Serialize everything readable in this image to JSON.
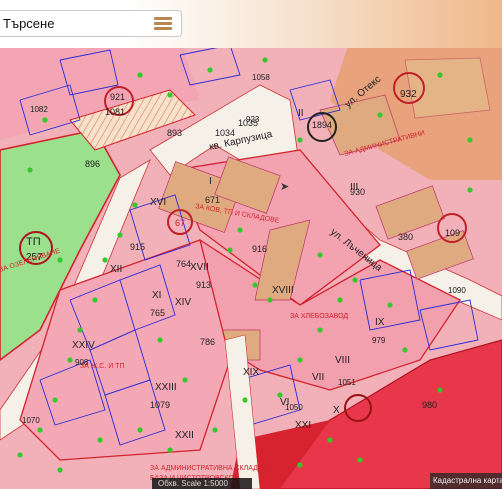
{
  "search": {
    "placeholder": "Търсене",
    "value": ""
  },
  "menu": {
    "icon": "hamburger-menu-icon"
  },
  "map": {
    "street_labels": [
      {
        "id": "karpuzitsa",
        "text": "кв. Карпузица"
      },
      {
        "id": "lachenitsa",
        "text": "ул. Лъченица"
      },
      {
        "id": "oteks",
        "text": "ул. Отекс"
      }
    ],
    "zone_labels": [
      {
        "id": "tp",
        "text": "ТП"
      },
      {
        "id": "num257",
        "text": "257"
      },
      {
        "id": "za_administrativni",
        "text": "ЗА АДМИНИСТРАТИВНИ"
      },
      {
        "id": "za_ozelenyavane",
        "text": "ЗА ОЗЕЛЕНЯВАНЕ"
      },
      {
        "id": "za_kov",
        "text": "ЗА КОВ, ТП И СКЛАДОВЕ"
      },
      {
        "id": "za_hlebozavod",
        "text": "ЗА ХЛЕБОЗАВОД"
      },
      {
        "id": "za_zh",
        "text": "ЗА Ж.С. И ТП"
      },
      {
        "id": "admin_skladova",
        "text": "ЗА АДМИНИСТРАТИВНА СКЛАДОВА"
      },
      {
        "id": "baza",
        "text": "БАЗА И ЧИСТОТРОВСКО"
      }
    ],
    "plot_numbers": [
      {
        "id": "p932",
        "text": "932"
      },
      {
        "id": "p1081",
        "text": "1081"
      },
      {
        "id": "p1034",
        "text": "1034"
      },
      {
        "id": "p1035",
        "text": "1035"
      },
      {
        "id": "p893",
        "text": "893"
      },
      {
        "id": "p896",
        "text": "896"
      },
      {
        "id": "p671",
        "text": "671"
      },
      {
        "id": "p916",
        "text": "916"
      },
      {
        "id": "p913",
        "text": "913"
      },
      {
        "id": "p915",
        "text": "915"
      },
      {
        "id": "p765",
        "text": "765"
      },
      {
        "id": "p764",
        "text": "764"
      },
      {
        "id": "p380",
        "text": "380"
      },
      {
        "id": "p109",
        "text": "109"
      },
      {
        "id": "p1090",
        "text": "1090"
      },
      {
        "id": "p979",
        "text": "979"
      },
      {
        "id": "p1079",
        "text": "1079"
      },
      {
        "id": "p908",
        "text": "908"
      },
      {
        "id": "p786",
        "text": "786"
      },
      {
        "id": "p1050",
        "text": "1050"
      },
      {
        "id": "p930",
        "text": "930"
      },
      {
        "id": "p1051",
        "text": "1051"
      },
      {
        "id": "p980",
        "text": "980"
      },
      {
        "id": "p1070",
        "text": "1070"
      },
      {
        "id": "p923",
        "text": "923"
      },
      {
        "id": "p1894",
        "text": "1894"
      },
      {
        "id": "p67",
        "text": "67"
      },
      {
        "id": "p921",
        "text": "921"
      },
      {
        "id": "p1082",
        "text": "1082"
      },
      {
        "id": "p1058",
        "text": "1058"
      }
    ],
    "roman_labels": [
      {
        "id": "rXVI",
        "text": "XVI"
      },
      {
        "id": "rXII",
        "text": "XII"
      },
      {
        "id": "rXI",
        "text": "XI"
      },
      {
        "id": "rXIV",
        "text": "XIV"
      },
      {
        "id": "rXVII",
        "text": "XVII"
      },
      {
        "id": "rXVIII",
        "text": "XVIII"
      },
      {
        "id": "rXXIV",
        "text": "XXIV"
      },
      {
        "id": "rXXIII",
        "text": "XXIII"
      },
      {
        "id": "rXXII",
        "text": "XXII"
      },
      {
        "id": "rXIX",
        "text": "XIX"
      },
      {
        "id": "rXXI",
        "text": "XXI"
      },
      {
        "id": "rVI",
        "text": "VI"
      },
      {
        "id": "rVII",
        "text": "VII"
      },
      {
        "id": "rVIII",
        "text": "VIII"
      },
      {
        "id": "rIX",
        "text": "IX"
      },
      {
        "id": "rX",
        "text": "X"
      },
      {
        "id": "rI",
        "text": "I"
      },
      {
        "id": "rII",
        "text": "II"
      },
      {
        "id": "rIII",
        "text": "III"
      }
    ]
  },
  "footer": {
    "scale_text": "Обхв. Scale 1:5000",
    "credit_text": "Кадастрална карта"
  },
  "colors": {
    "pink_zone": "#f3a3b0",
    "red_zone": "#e8374a",
    "green_zone": "#9be08c",
    "building": "#e0aa80",
    "road": "#f4efe7",
    "boundary_red": "#d4232d",
    "boundary_blue": "#2a2ad8",
    "tree_green": "#35c82b"
  }
}
